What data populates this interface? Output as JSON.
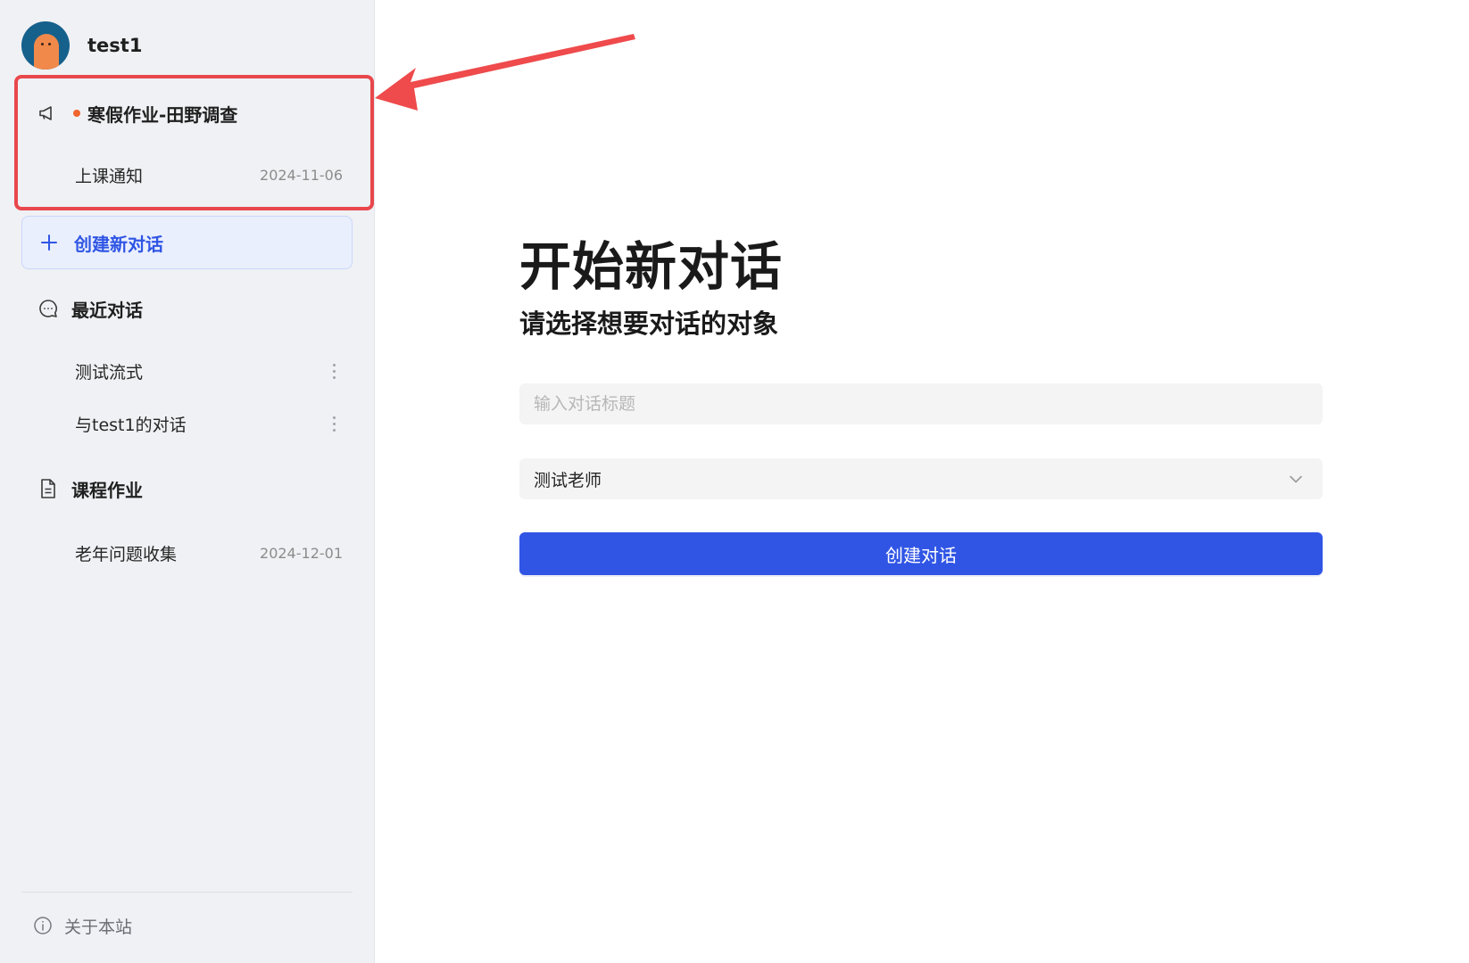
{
  "user": {
    "name": "test1"
  },
  "announcement": {
    "title": "寒假作业-田野调查",
    "items": [
      {
        "label": "上课通知",
        "date": "2024-11-06"
      }
    ]
  },
  "sidebar": {
    "new_chat_label": "创建新对话",
    "recent": {
      "label": "最近对话",
      "items": [
        {
          "label": "测试流式"
        },
        {
          "label": "与test1的对话"
        }
      ]
    },
    "coursework": {
      "label": "课程作业",
      "items": [
        {
          "label": "老年问题收集",
          "date": "2024-12-01"
        }
      ]
    },
    "about_label": "关于本站"
  },
  "main": {
    "title": "开始新对话",
    "subtitle": "请选择想要对话的对象",
    "title_input": {
      "placeholder": "输入对话标题",
      "value": ""
    },
    "target_select": {
      "value": "测试老师"
    },
    "create_button_label": "创建对话"
  },
  "colors": {
    "accent": "#3055e5",
    "highlight_box": "#e8474c",
    "unread_dot": "#f0642d",
    "sidebar_bg": "#f0f1f4"
  },
  "icons": {
    "announcement": "megaphone-icon",
    "new_chat": "plus-icon",
    "recent": "chat-bubble-icon",
    "coursework": "document-icon",
    "about": "info-icon",
    "select": "chevron-down-icon",
    "row_menu": "more-vertical-icon"
  }
}
